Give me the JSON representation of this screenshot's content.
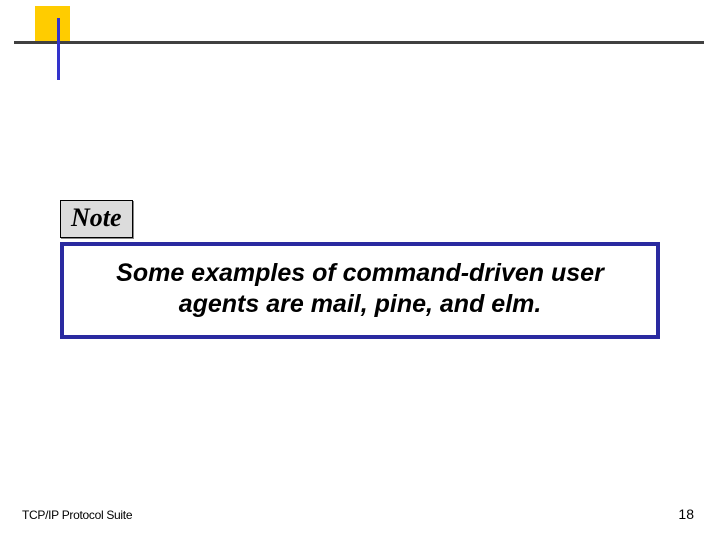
{
  "note": {
    "label": "Note",
    "text": "Some examples of command-driven user agents are mail, pine, and elm."
  },
  "footer": {
    "left": "TCP/IP Protocol Suite",
    "page": "18"
  }
}
